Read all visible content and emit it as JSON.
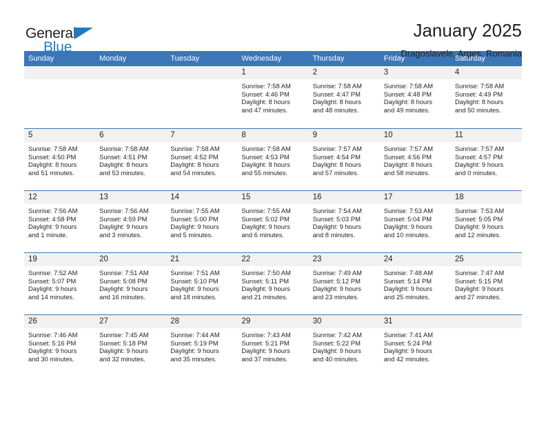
{
  "brand": {
    "word_one": "General",
    "word_two": "Blue",
    "accent_color": "#1f7bc1",
    "triangle_icon": "triangle-icon"
  },
  "header": {
    "title": "January 2025",
    "subtitle": "Dragoslavele, Arges, Romania"
  },
  "calendar": {
    "header_color": "#3b76b8",
    "day_band_color": "#f1f1f1",
    "weekday_names": [
      "Sunday",
      "Monday",
      "Tuesday",
      "Wednesday",
      "Thursday",
      "Friday",
      "Saturday"
    ],
    "weeks": [
      [
        {
          "day": "",
          "lines": []
        },
        {
          "day": "",
          "lines": []
        },
        {
          "day": "",
          "lines": []
        },
        {
          "day": "1",
          "lines": [
            "Sunrise: 7:58 AM",
            "Sunset: 4:46 PM",
            "Daylight: 8 hours",
            "and 47 minutes."
          ]
        },
        {
          "day": "2",
          "lines": [
            "Sunrise: 7:58 AM",
            "Sunset: 4:47 PM",
            "Daylight: 8 hours",
            "and 48 minutes."
          ]
        },
        {
          "day": "3",
          "lines": [
            "Sunrise: 7:58 AM",
            "Sunset: 4:48 PM",
            "Daylight: 8 hours",
            "and 49 minutes."
          ]
        },
        {
          "day": "4",
          "lines": [
            "Sunrise: 7:58 AM",
            "Sunset: 4:49 PM",
            "Daylight: 8 hours",
            "and 50 minutes."
          ]
        }
      ],
      [
        {
          "day": "5",
          "lines": [
            "Sunrise: 7:58 AM",
            "Sunset: 4:50 PM",
            "Daylight: 8 hours",
            "and 51 minutes."
          ]
        },
        {
          "day": "6",
          "lines": [
            "Sunrise: 7:58 AM",
            "Sunset: 4:51 PM",
            "Daylight: 8 hours",
            "and 53 minutes."
          ]
        },
        {
          "day": "7",
          "lines": [
            "Sunrise: 7:58 AM",
            "Sunset: 4:52 PM",
            "Daylight: 8 hours",
            "and 54 minutes."
          ]
        },
        {
          "day": "8",
          "lines": [
            "Sunrise: 7:58 AM",
            "Sunset: 4:53 PM",
            "Daylight: 8 hours",
            "and 55 minutes."
          ]
        },
        {
          "day": "9",
          "lines": [
            "Sunrise: 7:57 AM",
            "Sunset: 4:54 PM",
            "Daylight: 8 hours",
            "and 57 minutes."
          ]
        },
        {
          "day": "10",
          "lines": [
            "Sunrise: 7:57 AM",
            "Sunset: 4:56 PM",
            "Daylight: 8 hours",
            "and 58 minutes."
          ]
        },
        {
          "day": "11",
          "lines": [
            "Sunrise: 7:57 AM",
            "Sunset: 4:57 PM",
            "Daylight: 9 hours",
            "and 0 minutes."
          ]
        }
      ],
      [
        {
          "day": "12",
          "lines": [
            "Sunrise: 7:56 AM",
            "Sunset: 4:58 PM",
            "Daylight: 9 hours",
            "and 1 minute."
          ]
        },
        {
          "day": "13",
          "lines": [
            "Sunrise: 7:56 AM",
            "Sunset: 4:59 PM",
            "Daylight: 9 hours",
            "and 3 minutes."
          ]
        },
        {
          "day": "14",
          "lines": [
            "Sunrise: 7:55 AM",
            "Sunset: 5:00 PM",
            "Daylight: 9 hours",
            "and 5 minutes."
          ]
        },
        {
          "day": "15",
          "lines": [
            "Sunrise: 7:55 AM",
            "Sunset: 5:02 PM",
            "Daylight: 9 hours",
            "and 6 minutes."
          ]
        },
        {
          "day": "16",
          "lines": [
            "Sunrise: 7:54 AM",
            "Sunset: 5:03 PM",
            "Daylight: 9 hours",
            "and 8 minutes."
          ]
        },
        {
          "day": "17",
          "lines": [
            "Sunrise: 7:53 AM",
            "Sunset: 5:04 PM",
            "Daylight: 9 hours",
            "and 10 minutes."
          ]
        },
        {
          "day": "18",
          "lines": [
            "Sunrise: 7:53 AM",
            "Sunset: 5:05 PM",
            "Daylight: 9 hours",
            "and 12 minutes."
          ]
        }
      ],
      [
        {
          "day": "19",
          "lines": [
            "Sunrise: 7:52 AM",
            "Sunset: 5:07 PM",
            "Daylight: 9 hours",
            "and 14 minutes."
          ]
        },
        {
          "day": "20",
          "lines": [
            "Sunrise: 7:51 AM",
            "Sunset: 5:08 PM",
            "Daylight: 9 hours",
            "and 16 minutes."
          ]
        },
        {
          "day": "21",
          "lines": [
            "Sunrise: 7:51 AM",
            "Sunset: 5:10 PM",
            "Daylight: 9 hours",
            "and 18 minutes."
          ]
        },
        {
          "day": "22",
          "lines": [
            "Sunrise: 7:50 AM",
            "Sunset: 5:11 PM",
            "Daylight: 9 hours",
            "and 21 minutes."
          ]
        },
        {
          "day": "23",
          "lines": [
            "Sunrise: 7:49 AM",
            "Sunset: 5:12 PM",
            "Daylight: 9 hours",
            "and 23 minutes."
          ]
        },
        {
          "day": "24",
          "lines": [
            "Sunrise: 7:48 AM",
            "Sunset: 5:14 PM",
            "Daylight: 9 hours",
            "and 25 minutes."
          ]
        },
        {
          "day": "25",
          "lines": [
            "Sunrise: 7:47 AM",
            "Sunset: 5:15 PM",
            "Daylight: 9 hours",
            "and 27 minutes."
          ]
        }
      ],
      [
        {
          "day": "26",
          "lines": [
            "Sunrise: 7:46 AM",
            "Sunset: 5:16 PM",
            "Daylight: 9 hours",
            "and 30 minutes."
          ]
        },
        {
          "day": "27",
          "lines": [
            "Sunrise: 7:45 AM",
            "Sunset: 5:18 PM",
            "Daylight: 9 hours",
            "and 32 minutes."
          ]
        },
        {
          "day": "28",
          "lines": [
            "Sunrise: 7:44 AM",
            "Sunset: 5:19 PM",
            "Daylight: 9 hours",
            "and 35 minutes."
          ]
        },
        {
          "day": "29",
          "lines": [
            "Sunrise: 7:43 AM",
            "Sunset: 5:21 PM",
            "Daylight: 9 hours",
            "and 37 minutes."
          ]
        },
        {
          "day": "30",
          "lines": [
            "Sunrise: 7:42 AM",
            "Sunset: 5:22 PM",
            "Daylight: 9 hours",
            "and 40 minutes."
          ]
        },
        {
          "day": "31",
          "lines": [
            "Sunrise: 7:41 AM",
            "Sunset: 5:24 PM",
            "Daylight: 9 hours",
            "and 42 minutes."
          ]
        },
        {
          "day": "",
          "lines": []
        }
      ]
    ]
  }
}
